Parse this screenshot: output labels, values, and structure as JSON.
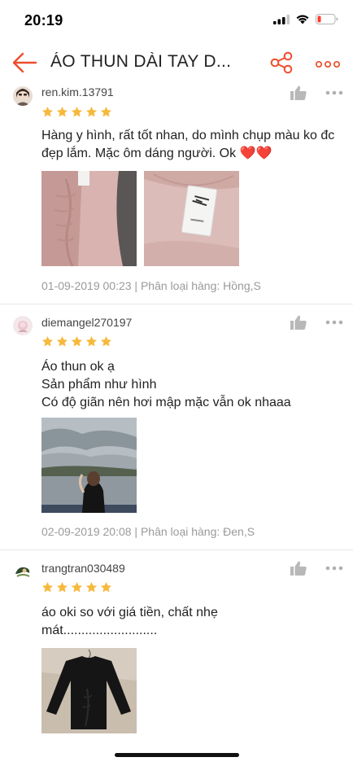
{
  "status_bar": {
    "time": "20:19",
    "icons": [
      "cellular-signal-icon",
      "wifi-icon",
      "battery-low-icon"
    ],
    "battery_color": "#ff3b30"
  },
  "nav": {
    "title": "ÁO THUN DÀI TAY D...",
    "icons": [
      "back-arrow-icon",
      "share-icon",
      "more-icon"
    ],
    "accent_color": "#ee4d2d"
  },
  "reviews": [
    {
      "username": "ren.kim.13791",
      "rating": 5,
      "comment": "Hàng y hình, rất tốt nhan, do mình chụp màu ko đc đẹp lắm. Mặc ôm dáng người.  Ok ❤️❤️",
      "photos": [
        "pink-ruched-top-photo",
        "pink-top-zara-tag-photo"
      ],
      "date": "01-09-2019 00:23",
      "variant": "Phân loại hàng: Hồng,S"
    },
    {
      "username": "diemangel270197",
      "rating": 5,
      "comment": "Áo thun ok ạ\nSản phẩm như hình\nCó độ giãn nên hơi mập mặc vẫn ok nhaaa",
      "photos": [
        "lake-landscape-woman-photo"
      ],
      "date": "02-09-2019 20:08",
      "variant": "Phân loại hàng: Đen,S"
    },
    {
      "username": "trangtran030489",
      "rating": 5,
      "comment": "áo oki so với giá tiền, chất nhẹ mát..........................",
      "photos": [
        "black-long-sleeve-top-photo"
      ]
    }
  ],
  "star_color": "#f6b93b"
}
